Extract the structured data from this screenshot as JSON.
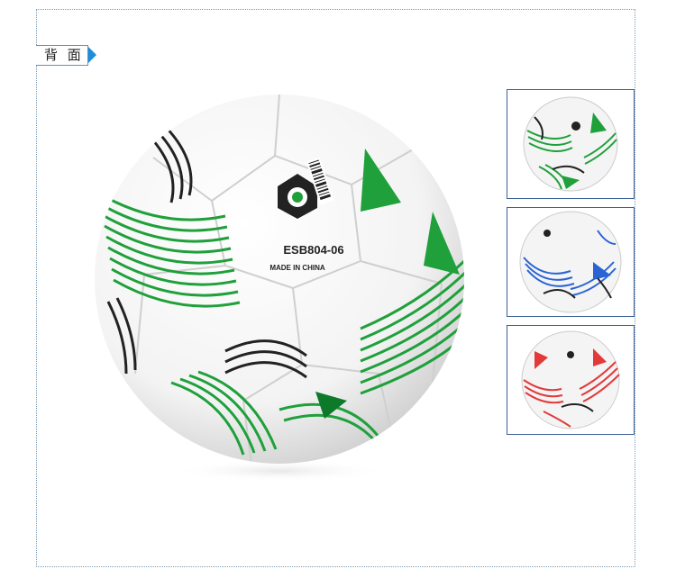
{
  "label": {
    "text": "背 面",
    "arrow_color": "#1a8fe0"
  },
  "main_ball": {
    "model": "ESB804-06",
    "origin": "MADE IN CHINA",
    "accent": "#1fa03a"
  },
  "thumbnails": [
    {
      "variant": "green",
      "accent": "#1fa03a"
    },
    {
      "variant": "blue",
      "accent": "#2a63d4"
    },
    {
      "variant": "red",
      "accent": "#e23a3a"
    }
  ]
}
